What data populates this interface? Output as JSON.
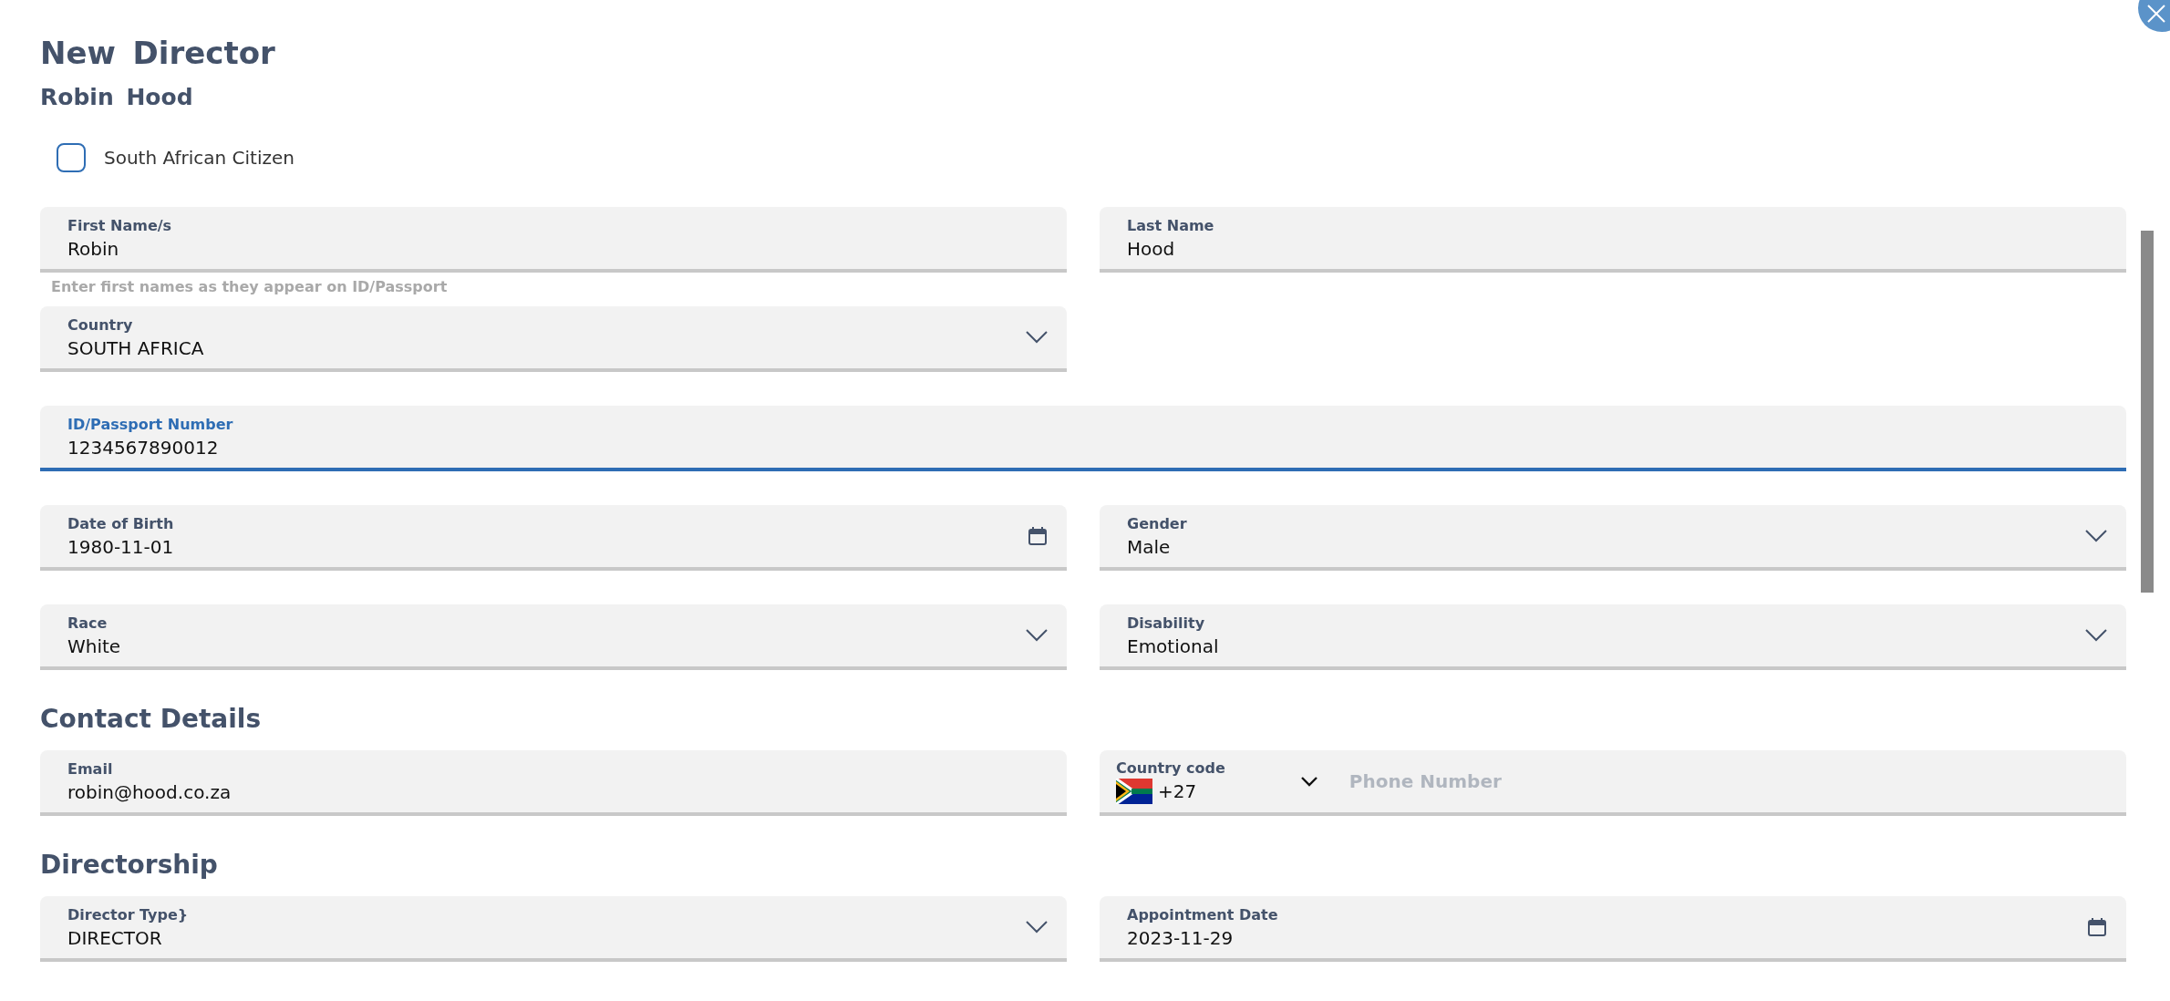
{
  "title": "New Director",
  "subtitle": "Robin Hood",
  "citizen": {
    "label": "South African Citizen",
    "checked": false
  },
  "sections": [
    {
      "rows": [
        {
          "fields": [
            {
              "kind": "text",
              "label": "First Name/s",
              "value": "Robin",
              "hint": "Enter first names as they appear on ID/Passport",
              "focused": false,
              "wide": false
            },
            {
              "kind": "text",
              "label": "Last Name",
              "value": "Hood",
              "focused": false,
              "wide": false
            }
          ]
        },
        {
          "fields": [
            {
              "kind": "select",
              "label": "Country",
              "value": "SOUTH AFRICA",
              "focused": false,
              "wide": false
            }
          ]
        },
        {
          "fields": [
            {
              "kind": "text",
              "label": "ID/Passport Number",
              "value": "1234567890012",
              "focused": true,
              "wide": true
            }
          ]
        },
        {
          "fields": [
            {
              "kind": "date",
              "label": "Date of Birth",
              "value": "1980-11-01",
              "focused": false,
              "wide": false
            },
            {
              "kind": "select",
              "label": "Gender",
              "value": "Male",
              "focused": false,
              "wide": false
            }
          ]
        },
        {
          "fields": [
            {
              "kind": "select",
              "label": "Race",
              "value": "White",
              "focused": false,
              "wide": false
            },
            {
              "kind": "select",
              "label": "Disability",
              "value": "Emotional",
              "focused": false,
              "wide": false
            }
          ]
        }
      ]
    },
    {
      "heading": "Contact Details",
      "rows": [
        {
          "fields": [
            {
              "kind": "text",
              "label": "Email",
              "value": "robin@hood.co.za",
              "focused": false,
              "wide": false
            },
            {
              "kind": "phone",
              "label": "Country code",
              "value": "+27",
              "placeholder": "Phone Number",
              "focused": false,
              "wide": false
            }
          ]
        }
      ]
    },
    {
      "heading": "Directorship",
      "rows": [
        {
          "fields": [
            {
              "kind": "select",
              "label": "Director Type}",
              "value": "DIRECTOR",
              "focused": false,
              "wide": false
            },
            {
              "kind": "date",
              "label": "Appointment Date",
              "value": "2023-11-29",
              "focused": false,
              "wide": false
            }
          ]
        }
      ]
    }
  ]
}
